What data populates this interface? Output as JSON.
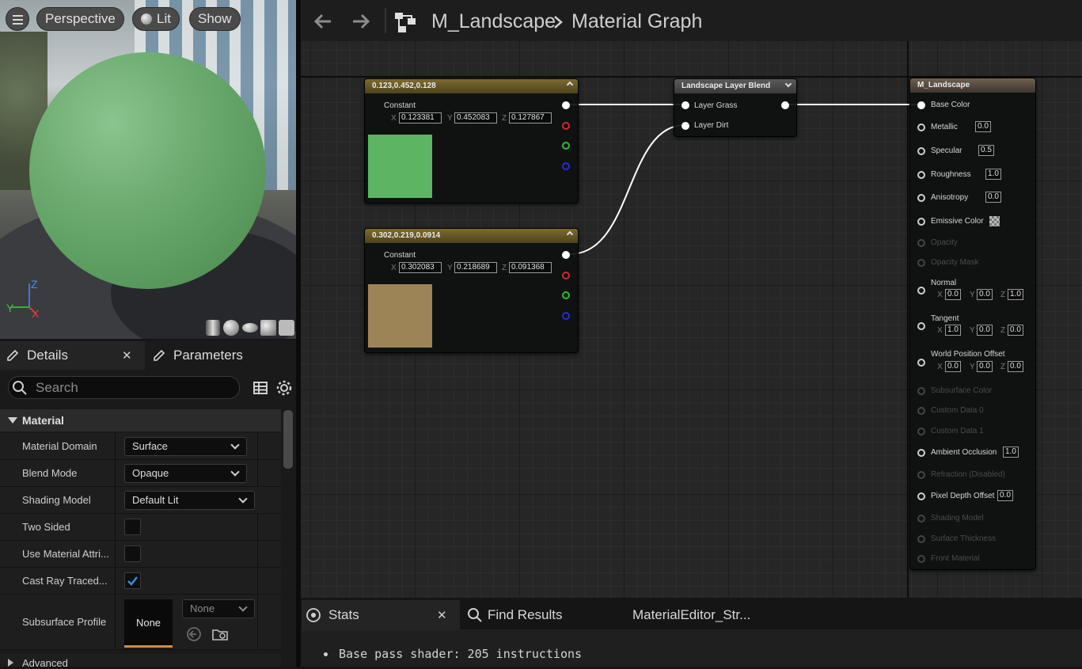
{
  "viewport": {
    "menu_icon": "hamburger-icon",
    "perspective_label": "Perspective",
    "lit_label": "Lit",
    "show_label": "Show",
    "axis": {
      "z": "Z",
      "y": "Y",
      "x": "X"
    },
    "preview_shapes": [
      "cylinder-icon",
      "sphere-icon",
      "plane-icon",
      "cube-icon",
      "custom-mesh-icon"
    ]
  },
  "tabs": {
    "details_label": "Details",
    "parameters_label": "Parameters"
  },
  "details": {
    "search_placeholder": "Search",
    "section_title": "Material",
    "rows": [
      {
        "label": "Material Domain",
        "value": "Surface"
      },
      {
        "label": "Blend Mode",
        "value": "Opaque"
      },
      {
        "label": "Shading Model",
        "value": "Default Lit"
      },
      {
        "label": "Two Sided",
        "checked": false
      },
      {
        "label": "Use Material Attri...",
        "checked": false
      },
      {
        "label": "Cast Ray Traced...",
        "checked": true
      },
      {
        "label": "Subsurface Profile",
        "thumb": "None",
        "combo": "None"
      }
    ],
    "advanced_label": "Advanced"
  },
  "toolbar": {
    "back_icon": "back-arrow-icon",
    "forward_icon": "forward-arrow-icon",
    "graph_icon": "graph-icon",
    "crumb_asset": "M_Landscape",
    "crumb_graph": "Material Graph"
  },
  "nodes": {
    "const1": {
      "title": "0.123,0.452,0.128",
      "label": "Constant",
      "x": "0.123381",
      "y": "0.452083",
      "z": "0.127867",
      "color": "#5db563"
    },
    "const2": {
      "title": "0.302,0.219,0.0914",
      "label": "Constant",
      "x": "0.302083",
      "y": "0.218689",
      "z": "0.091368",
      "color": "#9c8457"
    },
    "blend": {
      "title": "Landscape Layer Blend",
      "in1": "Layer Grass",
      "in2": "Layer Dirt"
    },
    "result": {
      "title": "M_Landscape",
      "base_color": "Base Color",
      "metallic": "Metallic",
      "metallic_v": "0.0",
      "specular": "Specular",
      "specular_v": "0.5",
      "roughness": "Roughness",
      "roughness_v": "1.0",
      "anisotropy": "Anisotropy",
      "anisotropy_v": "0.0",
      "emissive": "Emissive Color",
      "opacity": "Opacity",
      "opacity_mask": "Opacity Mask",
      "normal": "Normal",
      "normal_x": "0.0",
      "normal_y": "0.0",
      "normal_z": "1.0",
      "tangent": "Tangent",
      "tangent_x": "1.0",
      "tangent_y": "0.0",
      "tangent_z": "0.0",
      "wpo": "World Position Offset",
      "wpo_x": "0.0",
      "wpo_y": "0.0",
      "wpo_z": "0.0",
      "subsurface": "Subsurface Color",
      "cd0": "Custom Data 0",
      "cd1": "Custom Data 1",
      "ao": "Ambient Occlusion",
      "ao_v": "1.0",
      "refraction": "Refraction (Disabled)",
      "pdo": "Pixel Depth Offset",
      "pdo_v": "0.0",
      "shading": "Shading Model",
      "thickness": "Surface Thickness",
      "front": "Front Material"
    }
  },
  "bottom": {
    "stats_label": "Stats",
    "find_label": "Find Results",
    "third_label": "MaterialEditor_Str...",
    "stats_line": "Base pass shader: 205 instructions"
  }
}
